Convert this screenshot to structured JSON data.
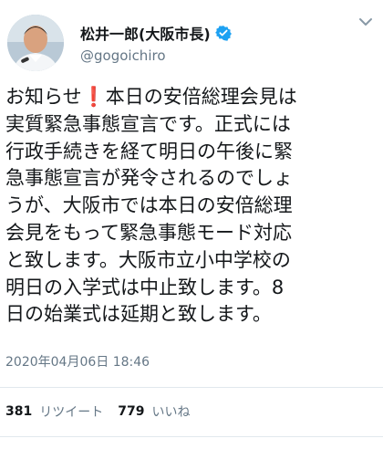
{
  "profile": {
    "display_name": "松井一郎(大阪市長)",
    "handle": "@gogoichiro",
    "verified": true,
    "avatar": "avatar-photo",
    "menu_icon": "chevron-down-icon"
  },
  "tweet": {
    "lines": [
      "お知らせ",
      "❗",
      "本日の安倍総理会見は",
      "実質緊急事態宣言です。正式には",
      "行政手続きを経て明日の午後に緊",
      "急事態宣言が発令されるのでしょ",
      "うが、大阪市では本日の安倍総理",
      "会見をもって緊急事態モード対応",
      "と致します。大阪市立小中学校の",
      "明日の入学式は中止致します。8",
      "日の始業式は延期と致します。"
    ],
    "timestamp": "2020年04月06日 18:46"
  },
  "stats": {
    "retweet_count": "381",
    "retweet_label": "リツイート",
    "like_count": "779",
    "like_label": "いいね"
  },
  "colors": {
    "text": "#14171a",
    "secondary": "#657786",
    "verified_blue": "#1da1f2",
    "divider": "#e1e8ed",
    "exclaim_red": "#e0102a"
  }
}
